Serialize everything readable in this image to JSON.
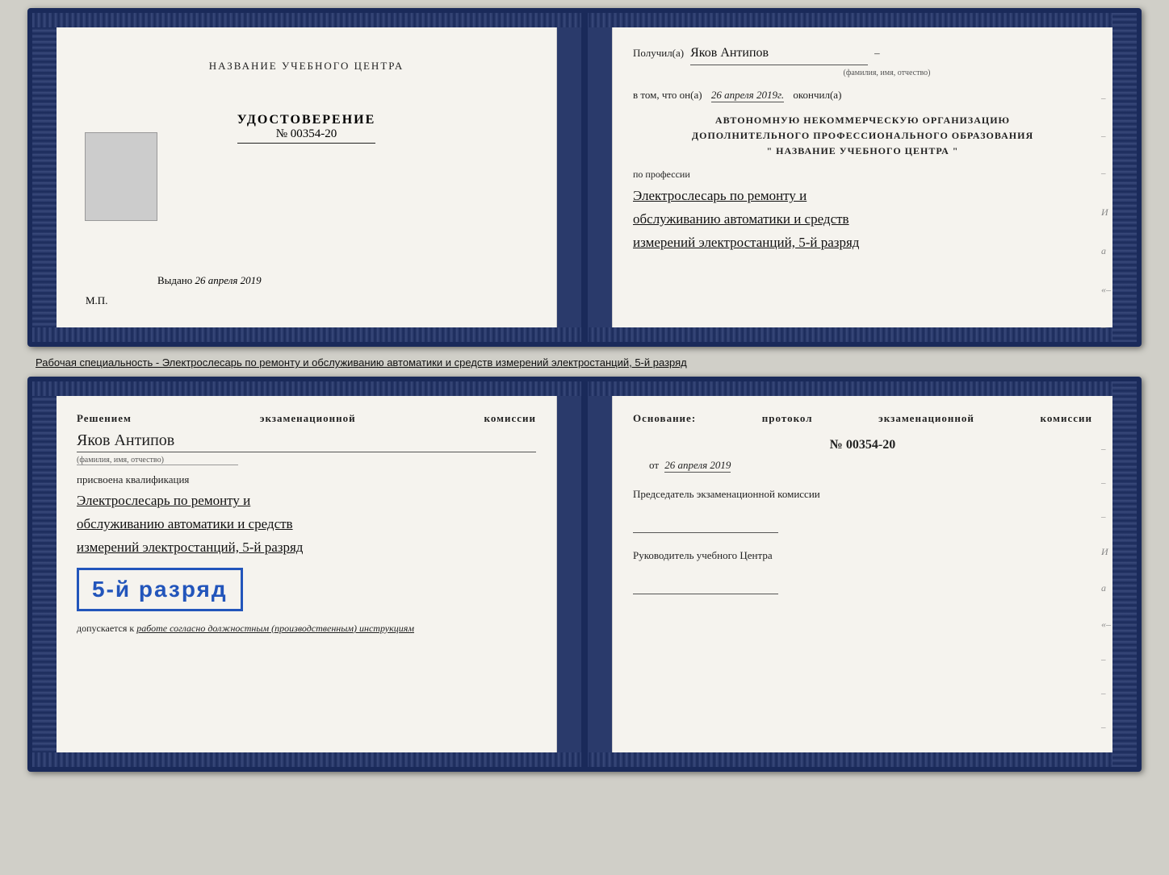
{
  "top_book": {
    "left": {
      "training_center": "НАЗВАНИЕ УЧЕБНОГО ЦЕНТРА",
      "cert_word": "УДОСТОВЕРЕНИЕ",
      "cert_number_label": "№",
      "cert_number": "00354-20",
      "issued_label": "Выдано",
      "issued_date": "26 апреля 2019",
      "mp_label": "М.П."
    },
    "right": {
      "received_label": "Получил(а)",
      "received_name": "Яков Антипов",
      "fio_label": "(фамилия, имя, отчество)",
      "in_that_label": "в том, что он(а)",
      "completion_date": "26 апреля 2019г.",
      "finished_label": "окончил(а)",
      "org_line1": "АВТОНОМНУЮ НЕКОММЕРЧЕСКУЮ ОРГАНИЗАЦИЮ",
      "org_line2": "ДОПОЛНИТЕЛЬНОГО ПРОФЕССИОНАЛЬНОГО ОБРАЗОВАНИЯ",
      "org_name": "\"  НАЗВАНИЕ УЧЕБНОГО ЦЕНТРА  \"",
      "profession_label": "по профессии",
      "profession_handwritten": "Электрослесарь по ремонту и",
      "profession_handwritten2": "обслуживанию автоматики и средств",
      "profession_handwritten3": "измерений электростанций, 5-й разряд"
    }
  },
  "between_label": "Рабочая специальность - Электрослесарь по ремонту и обслуживанию автоматики и средств измерений электростанций, 5-й разряд",
  "bottom_book": {
    "left": {
      "decision_text": "Решением экзаменационной комиссии",
      "person_name": "Яков Антипов",
      "fio_label": "(фамилия, имя, отчество)",
      "assigned_label": "присвоена квалификация",
      "qualification1": "Электрослесарь по ремонту и",
      "qualification2": "обслуживанию автоматики и средств",
      "qualification3": "измерений электростанций, 5-й разряд",
      "grade_stamp": "5-й разряд",
      "allowed_label": "допускается к",
      "allowed_text": "работе согласно должностным (производственным) инструкциям"
    },
    "right": {
      "basis_title": "Основание: протокол экзаменационной комиссии",
      "protocol_number": "№  00354-20",
      "protocol_date_label": "от",
      "protocol_date": "26 апреля 2019",
      "chairman_title": "Председатель экзаменационной комиссии",
      "director_title": "Руководитель учебного Центра"
    }
  },
  "edge_labels": {
    "И": "И",
    "а": "а",
    "«": "«"
  }
}
